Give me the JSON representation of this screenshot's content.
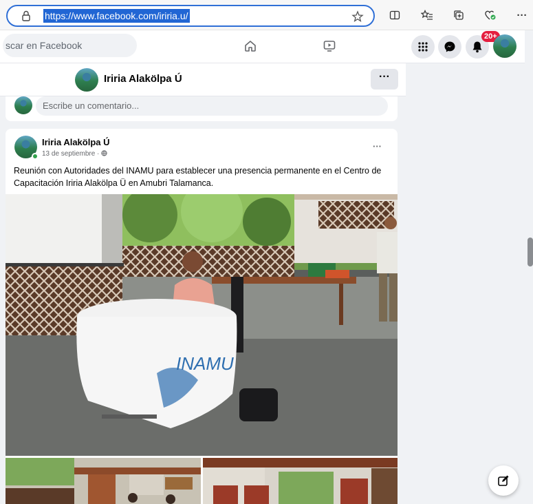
{
  "browser": {
    "url": "https://www.facebook.com/iriria.u/",
    "icons": [
      "lock-icon",
      "favorite-star-icon",
      "split-screen-icon",
      "favorites-icon",
      "collections-icon",
      "health-heart-icon",
      "more-icon"
    ],
    "more_label": "···"
  },
  "facebook": {
    "search_placeholder": "scar en Facebook",
    "notification_count": "20+",
    "icons": [
      "home-icon",
      "watch-icon",
      "menu-grid-icon",
      "messenger-icon",
      "bell-icon"
    ]
  },
  "profile_header": {
    "name": "Iriria Alakölpa Ú",
    "more_label": "···"
  },
  "comment": {
    "placeholder": "Escribe un comentario..."
  },
  "post": {
    "author": "Iriria Alakölpa Ú",
    "date": "13 de septiembre ·",
    "more_label": "···",
    "text": "Reunión con Autoridades del INAMU para establecer una presencia permanente en el Centro de Capacitación Iriria Alakölpa Ü en Amubri Talamanca.",
    "banner_text": "INAMU"
  },
  "colors": {
    "accent": "#2166d4",
    "badge": "#e41e3f",
    "messenger": "#1877f2"
  }
}
